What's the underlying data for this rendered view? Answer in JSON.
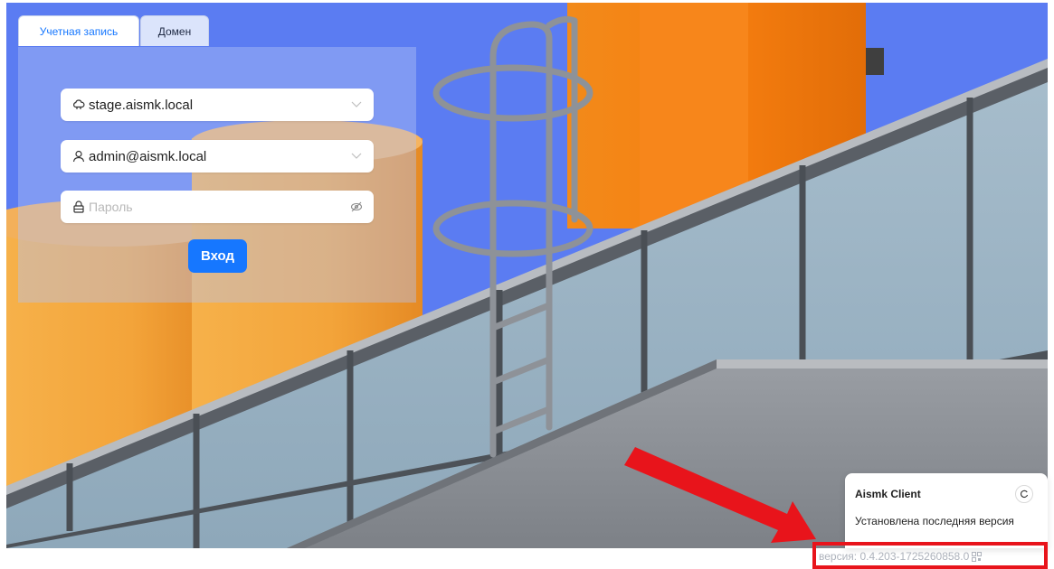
{
  "tabs": {
    "account": "Учетная запись",
    "domain": "Домен"
  },
  "login_form": {
    "server_value": "stage.aismk.local",
    "user_value": "admin@aismk.local",
    "password_placeholder": "Пароль",
    "login_button": "Вход"
  },
  "notification": {
    "title": "Aismk Client",
    "message": "Установлена последняя версия"
  },
  "footer": {
    "version": "версия: 0.4.203-1725260858.0"
  },
  "colors": {
    "accent": "#1677ff",
    "sky": "#5b7cf2",
    "annotation": "#e8141b"
  },
  "icons": {
    "server": "cloud-server-icon",
    "user": "user-icon",
    "password": "lock-icon",
    "visibility": "eye-invisible-icon",
    "dropdown": "chevron-down-icon",
    "refresh": "refresh-icon",
    "version": "qr-code-icon"
  }
}
